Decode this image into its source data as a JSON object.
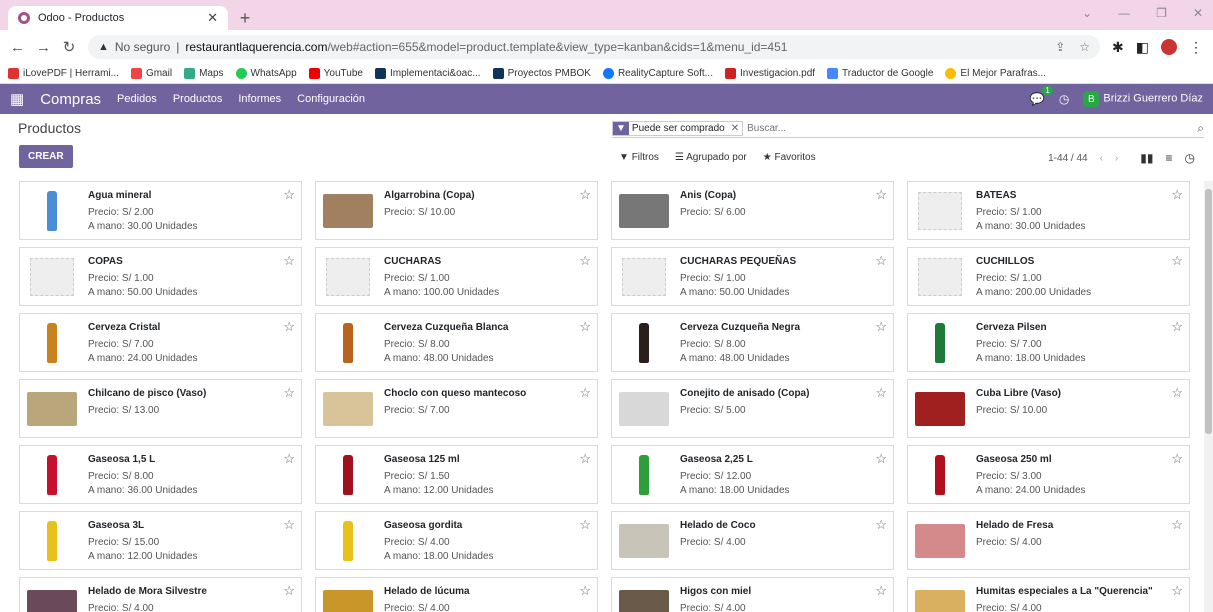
{
  "browser": {
    "tab_title": "Odoo - Productos",
    "url_warning": "No seguro",
    "url_domain": "restaurantlaquerencia.com",
    "url_path": "/web#action=655&model=product.template&view_type=kanban&cids=1&menu_id=451",
    "bookmarks": [
      "iLovePDF | Herrami...",
      "Gmail",
      "Maps",
      "WhatsApp",
      "YouTube",
      "Implementaci&oac...",
      "Proyectos PMBOK",
      "RealityCapture Soft...",
      "Investigacion.pdf",
      "Traductor de Google",
      "El Mejor Parafras..."
    ]
  },
  "odoo": {
    "app_name": "Compras",
    "menus": [
      "Pedidos",
      "Productos",
      "Informes",
      "Configuración"
    ],
    "chat_count": "1",
    "user_initial": "B",
    "user_name": "Brizzi Guerrero Díaz"
  },
  "control": {
    "breadcrumb": "Productos",
    "create_label": "CREAR",
    "facet_label": "Puede ser comprado",
    "search_placeholder": "Buscar...",
    "filters_label": "Filtros",
    "group_label": "Agrupado por",
    "favorites_label": "Favoritos",
    "pager": "1-44 / 44"
  },
  "products": [
    {
      "name": "Agua mineral",
      "price": "Precio: S/ 2.00",
      "stock": "A mano: 30.00 Unidades",
      "img": "bottle",
      "color": "#4a8fd6"
    },
    {
      "name": "Algarrobina (Copa)",
      "price": "Precio: S/ 10.00",
      "stock": "",
      "img": "photo",
      "color": "#a08060"
    },
    {
      "name": "Anis (Copa)",
      "price": "Precio: S/ 6.00",
      "stock": "",
      "img": "photo",
      "color": "#777"
    },
    {
      "name": "BATEAS",
      "price": "Precio: S/ 1.00",
      "stock": "A mano: 30.00 Unidades",
      "img": "placeholder",
      "color": ""
    },
    {
      "name": "COPAS",
      "price": "Precio: S/ 1.00",
      "stock": "A mano: 50.00 Unidades",
      "img": "placeholder",
      "color": ""
    },
    {
      "name": "CUCHARAS",
      "price": "Precio: S/ 1.00",
      "stock": "A mano: 100.00 Unidades",
      "img": "placeholder",
      "color": ""
    },
    {
      "name": "CUCHARAS PEQUEÑAS",
      "price": "Precio: S/ 1.00",
      "stock": "A mano: 50.00 Unidades",
      "img": "placeholder",
      "color": ""
    },
    {
      "name": "CUCHILLOS",
      "price": "Precio: S/ 1.00",
      "stock": "A mano: 200.00 Unidades",
      "img": "placeholder",
      "color": ""
    },
    {
      "name": "Cerveza Cristal",
      "price": "Precio: S/ 7.00",
      "stock": "A mano: 24.00 Unidades",
      "img": "bottle",
      "color": "#c9821e"
    },
    {
      "name": "Cerveza Cuzqueña Blanca",
      "price": "Precio: S/ 8.00",
      "stock": "A mano: 48.00 Unidades",
      "img": "bottle",
      "color": "#b8641c"
    },
    {
      "name": "Cerveza Cuzqueña Negra",
      "price": "Precio: S/ 8.00",
      "stock": "A mano: 48.00 Unidades",
      "img": "bottle",
      "color": "#2a1f1a"
    },
    {
      "name": "Cerveza Pilsen",
      "price": "Precio: S/ 7.00",
      "stock": "A mano: 18.00 Unidades",
      "img": "bottle",
      "color": "#1f7a3a"
    },
    {
      "name": "Chilcano de pisco (Vaso)",
      "price": "Precio: S/ 13.00",
      "stock": "",
      "img": "photo",
      "color": "#b9a67a"
    },
    {
      "name": "Choclo con queso mantecoso",
      "price": "Precio: S/ 7.00",
      "stock": "",
      "img": "photo",
      "color": "#d8c498"
    },
    {
      "name": "Conejito de anisado (Copa)",
      "price": "Precio: S/ 5.00",
      "stock": "",
      "img": "photo",
      "color": "#d8d8d8"
    },
    {
      "name": "Cuba Libre (Vaso)",
      "price": "Precio: S/ 10.00",
      "stock": "",
      "img": "photo",
      "color": "#a02020"
    },
    {
      "name": "Gaseosa 1,5 L",
      "price": "Precio: S/ 8.00",
      "stock": "A mano: 36.00 Unidades",
      "img": "bottle",
      "color": "#c8102e"
    },
    {
      "name": "Gaseosa 125 ml",
      "price": "Precio: S/ 1.50",
      "stock": "A mano: 12.00 Unidades",
      "img": "bottle",
      "color": "#a0101e"
    },
    {
      "name": "Gaseosa 2,25 L",
      "price": "Precio: S/ 12.00",
      "stock": "A mano: 18.00 Unidades",
      "img": "bottle",
      "color": "#2e9e3a"
    },
    {
      "name": "Gaseosa 250 ml",
      "price": "Precio: S/ 3.00",
      "stock": "A mano: 24.00 Unidades",
      "img": "bottle",
      "color": "#b0101e"
    },
    {
      "name": "Gaseosa 3L",
      "price": "Precio: S/ 15.00",
      "stock": "A mano: 12.00 Unidades",
      "img": "bottle",
      "color": "#e8c21a"
    },
    {
      "name": "Gaseosa gordita",
      "price": "Precio: S/ 4.00",
      "stock": "A mano: 18.00 Unidades",
      "img": "bottle",
      "color": "#e8c21a"
    },
    {
      "name": "Helado de Coco",
      "price": "Precio: S/ 4.00",
      "stock": "",
      "img": "photo",
      "color": "#c9c4b8"
    },
    {
      "name": "Helado de Fresa",
      "price": "Precio: S/ 4.00",
      "stock": "",
      "img": "photo",
      "color": "#d48a8a"
    },
    {
      "name": "Helado de Mora Silvestre",
      "price": "Precio: S/ 4.00",
      "stock": "",
      "img": "photo",
      "color": "#6a4a5a"
    },
    {
      "name": "Helado de lúcuma",
      "price": "Precio: S/ 4.00",
      "stock": "",
      "img": "photo",
      "color": "#c9962a"
    },
    {
      "name": "Higos con miel",
      "price": "Precio: S/ 4.00",
      "stock": "",
      "img": "photo",
      "color": "#6a5a4a"
    },
    {
      "name": "Humitas especiales a La \"Querencia\"",
      "price": "Precio: S/ 4.00",
      "stock": "",
      "img": "photo",
      "color": "#d8b060"
    }
  ]
}
